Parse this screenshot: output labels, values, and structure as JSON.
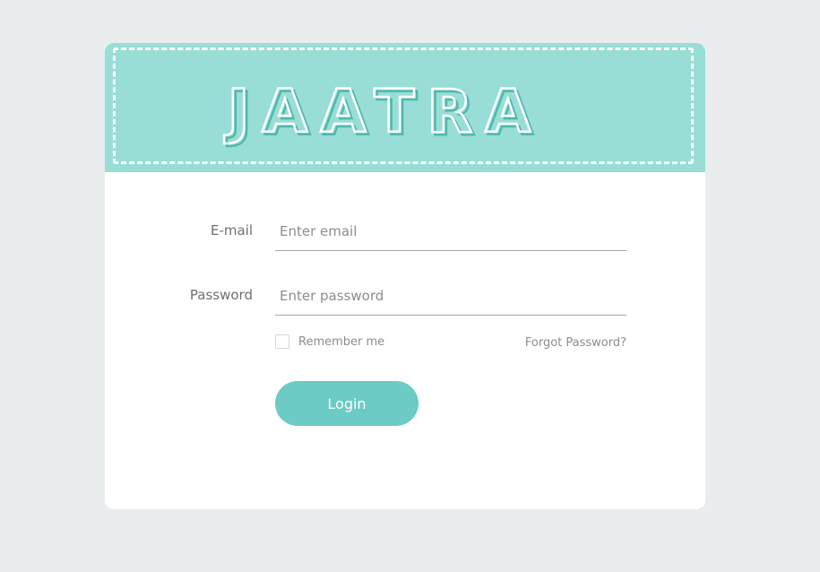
{
  "brand": {
    "logo_text": "JAATRA",
    "header_color": "#99ddd7",
    "accent_color": "#6ccbc4"
  },
  "form": {
    "email_label": "E-mail",
    "email_placeholder": "Enter email",
    "email_value": "",
    "password_label": "Password",
    "password_placeholder": "Enter password",
    "password_value": "",
    "remember_label": "Remember me",
    "remember_checked": false,
    "forgot_label": "Forgot Password?",
    "login_label": "Login"
  }
}
